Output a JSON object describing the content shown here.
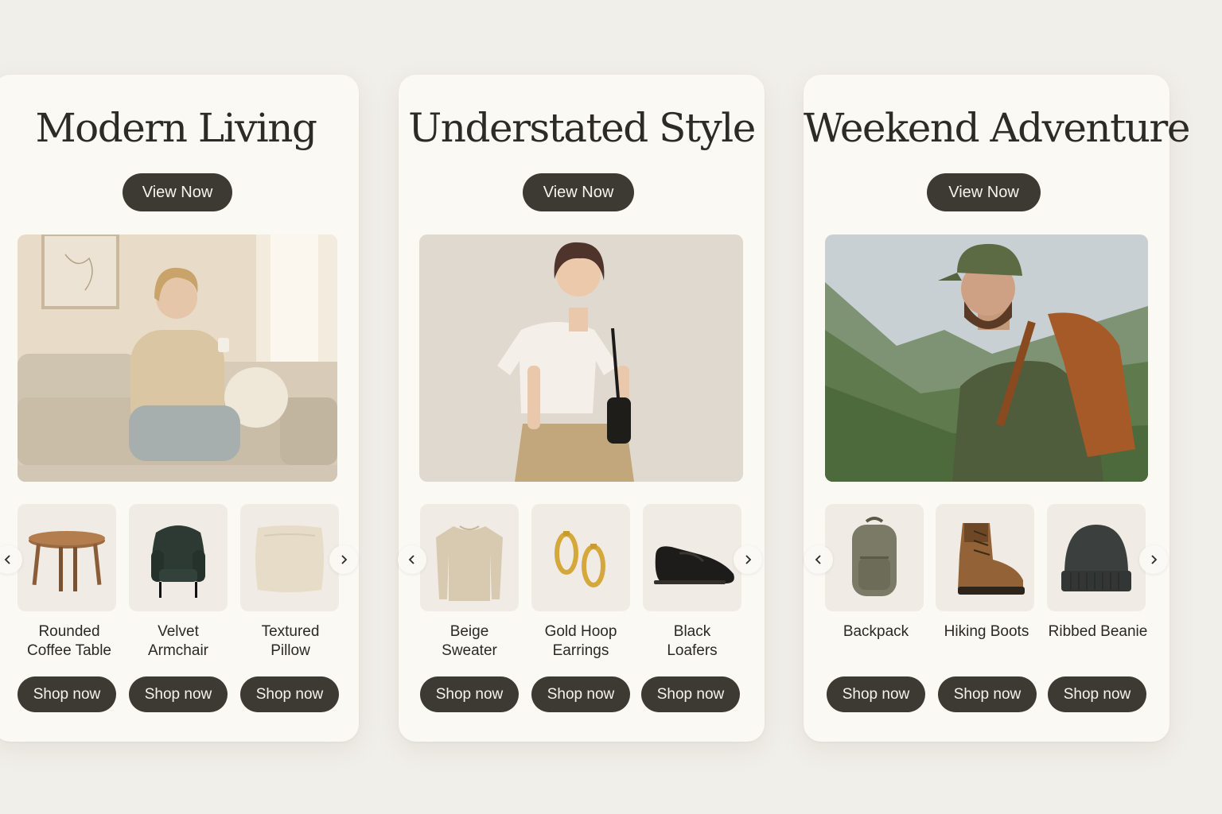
{
  "cards": [
    {
      "title": "Modern Living",
      "view_label": "View Now",
      "products": [
        {
          "name": "Rounded\nCoffee Table",
          "cta": "Shop now",
          "icon": "coffee-table-icon"
        },
        {
          "name": "Velvet\nArmchair",
          "cta": "Shop now",
          "icon": "armchair-icon"
        },
        {
          "name": "Textured\nPillow",
          "cta": "Shop now",
          "icon": "pillow-icon"
        }
      ]
    },
    {
      "title": "Understated Style",
      "view_label": "View Now",
      "products": [
        {
          "name": "Beige\nSweater",
          "cta": "Shop now",
          "icon": "sweater-icon"
        },
        {
          "name": "Gold Hoop\nEarrings",
          "cta": "Shop now",
          "icon": "earrings-icon"
        },
        {
          "name": "Black\nLoafers",
          "cta": "Shop now",
          "icon": "loafer-icon"
        }
      ]
    },
    {
      "title": "Weekend Adventure",
      "view_label": "View Now",
      "products": [
        {
          "name": "Backpack",
          "cta": "Shop now",
          "icon": "backpack-icon"
        },
        {
          "name": "Hiking Boots",
          "cta": "Shop now",
          "icon": "hiking-boot-icon"
        },
        {
          "name": "Ribbed Beanie",
          "cta": "Shop now",
          "icon": "beanie-icon"
        }
      ]
    }
  ],
  "colors": {
    "page_background": "#f1efea",
    "card_background": "#fbf9f4",
    "button": "#3d3a34",
    "button_text": "#f6f3ec",
    "tile_background": "#f0ece5"
  }
}
